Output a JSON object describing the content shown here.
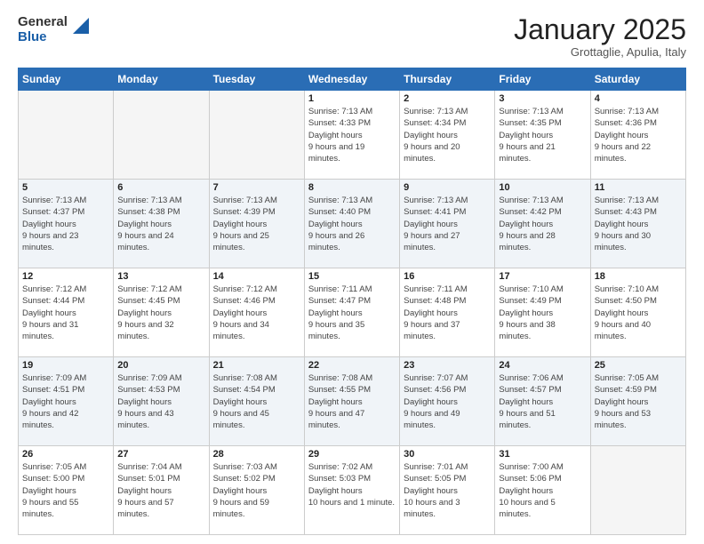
{
  "logo": {
    "general": "General",
    "blue": "Blue"
  },
  "title": "January 2025",
  "subtitle": "Grottaglie, Apulia, Italy",
  "days_header": [
    "Sunday",
    "Monday",
    "Tuesday",
    "Wednesday",
    "Thursday",
    "Friday",
    "Saturday"
  ],
  "weeks": [
    [
      {
        "day": "",
        "empty": true
      },
      {
        "day": "",
        "empty": true
      },
      {
        "day": "",
        "empty": true
      },
      {
        "day": "1",
        "sunrise": "7:13 AM",
        "sunset": "4:33 PM",
        "daylight": "9 hours and 19 minutes."
      },
      {
        "day": "2",
        "sunrise": "7:13 AM",
        "sunset": "4:34 PM",
        "daylight": "9 hours and 20 minutes."
      },
      {
        "day": "3",
        "sunrise": "7:13 AM",
        "sunset": "4:35 PM",
        "daylight": "9 hours and 21 minutes."
      },
      {
        "day": "4",
        "sunrise": "7:13 AM",
        "sunset": "4:36 PM",
        "daylight": "9 hours and 22 minutes."
      }
    ],
    [
      {
        "day": "5",
        "sunrise": "7:13 AM",
        "sunset": "4:37 PM",
        "daylight": "9 hours and 23 minutes."
      },
      {
        "day": "6",
        "sunrise": "7:13 AM",
        "sunset": "4:38 PM",
        "daylight": "9 hours and 24 minutes."
      },
      {
        "day": "7",
        "sunrise": "7:13 AM",
        "sunset": "4:39 PM",
        "daylight": "9 hours and 25 minutes."
      },
      {
        "day": "8",
        "sunrise": "7:13 AM",
        "sunset": "4:40 PM",
        "daylight": "9 hours and 26 minutes."
      },
      {
        "day": "9",
        "sunrise": "7:13 AM",
        "sunset": "4:41 PM",
        "daylight": "9 hours and 27 minutes."
      },
      {
        "day": "10",
        "sunrise": "7:13 AM",
        "sunset": "4:42 PM",
        "daylight": "9 hours and 28 minutes."
      },
      {
        "day": "11",
        "sunrise": "7:13 AM",
        "sunset": "4:43 PM",
        "daylight": "9 hours and 30 minutes."
      }
    ],
    [
      {
        "day": "12",
        "sunrise": "7:12 AM",
        "sunset": "4:44 PM",
        "daylight": "9 hours and 31 minutes."
      },
      {
        "day": "13",
        "sunrise": "7:12 AM",
        "sunset": "4:45 PM",
        "daylight": "9 hours and 32 minutes."
      },
      {
        "day": "14",
        "sunrise": "7:12 AM",
        "sunset": "4:46 PM",
        "daylight": "9 hours and 34 minutes."
      },
      {
        "day": "15",
        "sunrise": "7:11 AM",
        "sunset": "4:47 PM",
        "daylight": "9 hours and 35 minutes."
      },
      {
        "day": "16",
        "sunrise": "7:11 AM",
        "sunset": "4:48 PM",
        "daylight": "9 hours and 37 minutes."
      },
      {
        "day": "17",
        "sunrise": "7:10 AM",
        "sunset": "4:49 PM",
        "daylight": "9 hours and 38 minutes."
      },
      {
        "day": "18",
        "sunrise": "7:10 AM",
        "sunset": "4:50 PM",
        "daylight": "9 hours and 40 minutes."
      }
    ],
    [
      {
        "day": "19",
        "sunrise": "7:09 AM",
        "sunset": "4:51 PM",
        "daylight": "9 hours and 42 minutes."
      },
      {
        "day": "20",
        "sunrise": "7:09 AM",
        "sunset": "4:53 PM",
        "daylight": "9 hours and 43 minutes."
      },
      {
        "day": "21",
        "sunrise": "7:08 AM",
        "sunset": "4:54 PM",
        "daylight": "9 hours and 45 minutes."
      },
      {
        "day": "22",
        "sunrise": "7:08 AM",
        "sunset": "4:55 PM",
        "daylight": "9 hours and 47 minutes."
      },
      {
        "day": "23",
        "sunrise": "7:07 AM",
        "sunset": "4:56 PM",
        "daylight": "9 hours and 49 minutes."
      },
      {
        "day": "24",
        "sunrise": "7:06 AM",
        "sunset": "4:57 PM",
        "daylight": "9 hours and 51 minutes."
      },
      {
        "day": "25",
        "sunrise": "7:05 AM",
        "sunset": "4:59 PM",
        "daylight": "9 hours and 53 minutes."
      }
    ],
    [
      {
        "day": "26",
        "sunrise": "7:05 AM",
        "sunset": "5:00 PM",
        "daylight": "9 hours and 55 minutes."
      },
      {
        "day": "27",
        "sunrise": "7:04 AM",
        "sunset": "5:01 PM",
        "daylight": "9 hours and 57 minutes."
      },
      {
        "day": "28",
        "sunrise": "7:03 AM",
        "sunset": "5:02 PM",
        "daylight": "9 hours and 59 minutes."
      },
      {
        "day": "29",
        "sunrise": "7:02 AM",
        "sunset": "5:03 PM",
        "daylight": "10 hours and 1 minute."
      },
      {
        "day": "30",
        "sunrise": "7:01 AM",
        "sunset": "5:05 PM",
        "daylight": "10 hours and 3 minutes."
      },
      {
        "day": "31",
        "sunrise": "7:00 AM",
        "sunset": "5:06 PM",
        "daylight": "10 hours and 5 minutes."
      },
      {
        "day": "",
        "empty": true
      }
    ]
  ],
  "labels": {
    "sunrise": "Sunrise:",
    "sunset": "Sunset:",
    "daylight": "Daylight hours"
  }
}
